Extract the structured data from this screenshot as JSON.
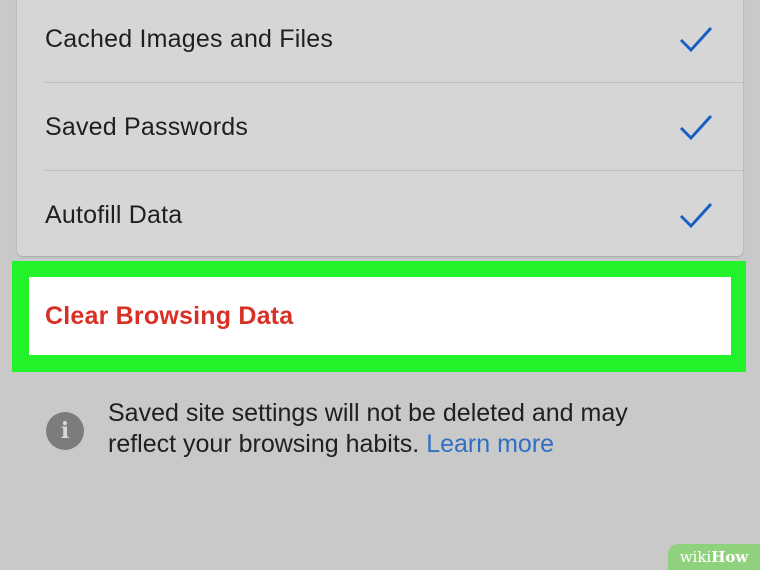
{
  "settings": {
    "items": [
      {
        "label": "Cached Images and Files",
        "checked": true,
        "icon": "check-icon"
      },
      {
        "label": "Saved Passwords",
        "checked": true,
        "icon": "check-icon"
      },
      {
        "label": "Autofill Data",
        "checked": true,
        "icon": "check-icon"
      }
    ],
    "clear_button_label": "Clear Browsing Data",
    "info": {
      "icon": "info-icon",
      "icon_glyph": "i",
      "message": "Saved site settings will not be deleted and may reflect your browsing habits.",
      "link_text": "Learn more"
    }
  },
  "watermark": {
    "part1": "wiki",
    "part2": "How"
  },
  "colors": {
    "check": "#1a5fc4",
    "clear_button_text": "#d93025",
    "highlight": "#22f22a",
    "link": "#2f6fc4",
    "background": "#c9c9c9"
  }
}
